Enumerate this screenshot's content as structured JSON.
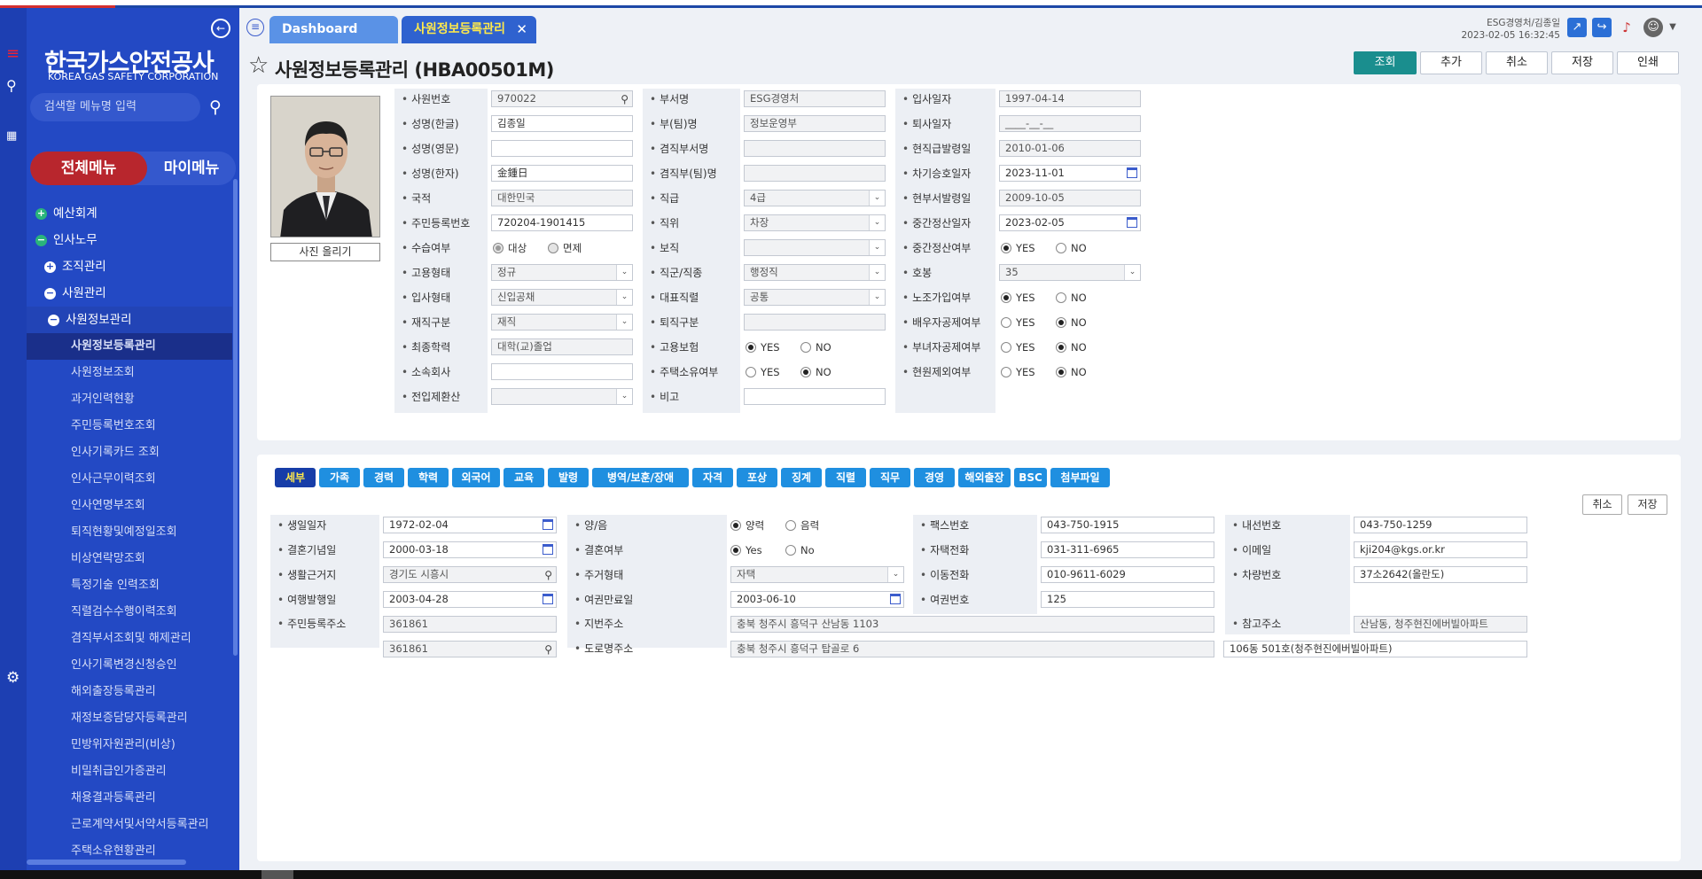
{
  "sidebar": {
    "logo_title": "한국가스안전공사",
    "logo_sub": "KOREA GAS SAFETY CORPORATION",
    "search_placeholder": "검색할 메뉴명 입력",
    "tab_all": "전체메뉴",
    "tab_my": "마이메뉴",
    "tree": [
      {
        "label": "예산회계",
        "level": 1,
        "icon": "plus"
      },
      {
        "label": "인사노무",
        "level": 1,
        "icon": "minus"
      },
      {
        "label": "조직관리",
        "level": 2,
        "icon": "plus"
      },
      {
        "label": "사원관리",
        "level": 2,
        "icon": "minus"
      },
      {
        "label": "사원정보관리",
        "level": 3,
        "icon": "minus"
      },
      {
        "label": "사원정보등록관리",
        "level": 4,
        "active": true
      },
      {
        "label": "사원정보조회",
        "level": 4
      },
      {
        "label": "과거인력현황",
        "level": 4
      },
      {
        "label": "주민등록번호조회",
        "level": 4
      },
      {
        "label": "인사기록카드 조회",
        "level": 4
      },
      {
        "label": "인사근무이력조회",
        "level": 4
      },
      {
        "label": "인사연명부조회",
        "level": 4
      },
      {
        "label": "퇴직현황및예정일조회",
        "level": 4
      },
      {
        "label": "비상연락망조회",
        "level": 4
      },
      {
        "label": "특정기술 인력조회",
        "level": 4
      },
      {
        "label": "직렬검수수행이력조회",
        "level": 4
      },
      {
        "label": "겸직부서조회및 해제관리",
        "level": 4
      },
      {
        "label": "인사기록변경신청승인",
        "level": 4
      },
      {
        "label": "해외출장등록관리",
        "level": 4
      },
      {
        "label": "재정보증담당자등록관리",
        "level": 4
      },
      {
        "label": "민방위자원관리(비상)",
        "level": 4
      },
      {
        "label": "비밀취급인가증관리",
        "level": 4
      },
      {
        "label": "채용결과등록관리",
        "level": 4
      },
      {
        "label": "근로계약서및서약서등록관리",
        "level": 4
      },
      {
        "label": "주택소유현황관리",
        "level": 4
      }
    ]
  },
  "header": {
    "tab_dashboard": "Dashboard",
    "tab_current": "사원정보등록관리",
    "tab_close": "✕",
    "user": "ESG경영처/김종일",
    "datetime": "2023-02-05 16:32:45"
  },
  "page": {
    "title": "사원정보등록관리 (HBA00501M)",
    "buttons": {
      "search": "조회",
      "add": "추가",
      "cancel": "취소",
      "save": "저장",
      "print": "인쇄"
    },
    "photo_button": "사진 올리기"
  },
  "form1": {
    "col1": [
      {
        "label": "사원번호",
        "value": "970022",
        "type": "search"
      },
      {
        "label": "성명(한글)",
        "value": "김종일",
        "type": "text"
      },
      {
        "label": "성명(영문)",
        "value": "",
        "type": "text"
      },
      {
        "label": "성명(한자)",
        "value": "金鍾日",
        "type": "text"
      },
      {
        "label": "국적",
        "value": "대한민국",
        "type": "ro"
      },
      {
        "label": "주민등록번호",
        "value": "720204-1901415",
        "type": "text"
      },
      {
        "label": "수습여부",
        "type": "radio",
        "options": [
          "대상",
          "면제"
        ],
        "selected": 0,
        "disabled": true
      },
      {
        "label": "고용형태",
        "value": "정규",
        "type": "select"
      },
      {
        "label": "입사형태",
        "value": "신입공채",
        "type": "select"
      },
      {
        "label": "재직구분",
        "value": "재직",
        "type": "select"
      },
      {
        "label": "최종학력",
        "value": "대학(교)졸업",
        "type": "ro"
      },
      {
        "label": "소속회사",
        "value": "",
        "type": "text"
      },
      {
        "label": "전입제환산",
        "value": "",
        "type": "select"
      }
    ],
    "col2": [
      {
        "label": "부서명",
        "value": "ESG경영처",
        "type": "ro"
      },
      {
        "label": "부(팀)명",
        "value": "정보운영부",
        "type": "ro"
      },
      {
        "label": "겸직부서명",
        "value": "",
        "type": "ro"
      },
      {
        "label": "겸직부(팀)명",
        "value": "",
        "type": "ro"
      },
      {
        "label": "직급",
        "value": "4급",
        "type": "select"
      },
      {
        "label": "직위",
        "value": "차장",
        "type": "select"
      },
      {
        "label": "보직",
        "value": "",
        "type": "select"
      },
      {
        "label": "직군/직종",
        "value": "행정직",
        "type": "select"
      },
      {
        "label": "대표직렬",
        "value": "공통",
        "type": "select"
      },
      {
        "label": "퇴직구분",
        "value": "",
        "type": "ro"
      },
      {
        "label": "고용보험",
        "type": "radio",
        "options": [
          "YES",
          "NO"
        ],
        "selected": 0
      },
      {
        "label": "주택소유여부",
        "type": "radio",
        "options": [
          "YES",
          "NO"
        ],
        "selected": 1
      },
      {
        "label": "비고",
        "value": "",
        "type": "text"
      }
    ],
    "col3": [
      {
        "label": "입사일자",
        "value": "1997-04-14",
        "type": "ro"
      },
      {
        "label": "퇴사일자",
        "value": "____-__-__",
        "type": "ro"
      },
      {
        "label": "현직급발령일",
        "value": "2010-01-06",
        "type": "ro"
      },
      {
        "label": "차기승호일자",
        "value": "2023-11-01",
        "type": "date"
      },
      {
        "label": "현부서발령일",
        "value": "2009-10-05",
        "type": "ro"
      },
      {
        "label": "중간정산일자",
        "value": "2023-02-05",
        "type": "date"
      },
      {
        "label": "중간정산여부",
        "type": "radio",
        "options": [
          "YES",
          "NO"
        ],
        "selected": 0
      },
      {
        "label": "호봉",
        "value": "35",
        "type": "select"
      },
      {
        "label": "노조가입여부",
        "type": "radio",
        "options": [
          "YES",
          "NO"
        ],
        "selected": 0
      },
      {
        "label": "배우자공제여부",
        "type": "radio",
        "options": [
          "YES",
          "NO"
        ],
        "selected": 1
      },
      {
        "label": "부녀자공제여부",
        "type": "radio",
        "options": [
          "YES",
          "NO"
        ],
        "selected": 1
      },
      {
        "label": "현원제외여부",
        "type": "radio",
        "options": [
          "YES",
          "NO"
        ],
        "selected": 1
      }
    ]
  },
  "subtabs": [
    "세부",
    "가족",
    "경력",
    "학력",
    "외국어",
    "교육",
    "발령",
    "병역/보훈/장애",
    "자격",
    "포상",
    "징계",
    "직렬",
    "직무",
    "경영",
    "해외출장",
    "BSC",
    "첨부파일"
  ],
  "subtab_active": 0,
  "sub_buttons": {
    "cancel": "취소",
    "save": "저장"
  },
  "form2": {
    "birth_label": "생일일자",
    "birth": "1972-02-04",
    "solar_label": "양/음",
    "solar_opts": [
      "양력",
      "음력"
    ],
    "solar_sel": 0,
    "fax_label": "팩스번호",
    "fax": "043-750-1915",
    "ext_label": "내선번호",
    "ext": "043-750-1259",
    "wedding_label": "결혼기념일",
    "wedding": "2000-03-18",
    "married_label": "결혼여부",
    "married_opts": [
      "Yes",
      "No"
    ],
    "married_sel": 0,
    "home_label": "자택전화",
    "home": "031-311-6965",
    "email_label": "이메일",
    "email": "kji204@kgs.or.kr",
    "living_label": "생활근거지",
    "living": "경기도 시흥시",
    "house_label": "주거형태",
    "house": "자택",
    "mobile_label": "이동전화",
    "mobile": "010-9611-6029",
    "car_label": "차량번호",
    "car": "37소2642(올란도)",
    "travel_label": "여행발행일",
    "travel": "2003-04-28",
    "passexp_label": "여권만료일",
    "passexp": "2003-06-10",
    "passno_label": "여권번호",
    "passno": "125",
    "resaddr_label": "주민등록주소",
    "resaddr1": "361861",
    "resaddr2": "361861",
    "jibun_label": "지번주소",
    "jibun": "충북 청주시 흥덕구 산남동 1103",
    "ref_label": "참고주소",
    "ref": "산남동, 청주현진에버빌아파트",
    "road_label": "도로명주소",
    "road": "충북 청주시 흥덕구 탑골로 6",
    "road_detail": "106동 501호(청주현진에버빌아파트)"
  }
}
